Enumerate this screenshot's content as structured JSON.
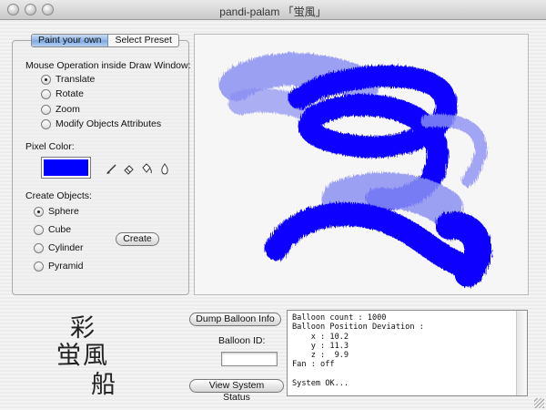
{
  "window": {
    "title": "pandi-palam 「蛍風」"
  },
  "tabs": {
    "paint_own": "Paint your own",
    "select_preset": "Select Preset",
    "active": "Paint your own"
  },
  "mouse_op": {
    "heading": "Mouse Operation inside Draw Window:",
    "options": [
      {
        "label": "Translate",
        "selected": true
      },
      {
        "label": "Rotate",
        "selected": false
      },
      {
        "label": "Zoom",
        "selected": false
      },
      {
        "label": "Modify Objects Attributes",
        "selected": false
      }
    ]
  },
  "pixel_color": {
    "label": "Pixel Color:",
    "value": "#0000ff"
  },
  "tools": [
    "brush-icon",
    "eraser-icon",
    "bucket-icon",
    "dropper-icon"
  ],
  "create_objects": {
    "heading": "Create Objects:",
    "options": [
      {
        "label": "Sphere",
        "selected": true
      },
      {
        "label": "Cube",
        "selected": false
      },
      {
        "label": "Cylinder",
        "selected": false
      },
      {
        "label": "Pyramid",
        "selected": false
      }
    ],
    "button": "Create"
  },
  "logo": {
    "chars": [
      "彩",
      "蛍風",
      "船"
    ]
  },
  "buttons": {
    "dump": "Dump Balloon Info",
    "view_status": "View System Status"
  },
  "balloon_id": {
    "label": "Balloon ID:",
    "value": ""
  },
  "console": {
    "lines": [
      "Balloon count : 1000",
      "Balloon Position Deviation :",
      "    x : 10.2",
      "    y : 11.3",
      "    z :  9.9",
      "Fan : off",
      "",
      "System OK..."
    ]
  },
  "colors": {
    "stroke_dark": "#0a06ff",
    "stroke_light": "#8c90f2",
    "accent_tab": "#8fb4e6"
  }
}
